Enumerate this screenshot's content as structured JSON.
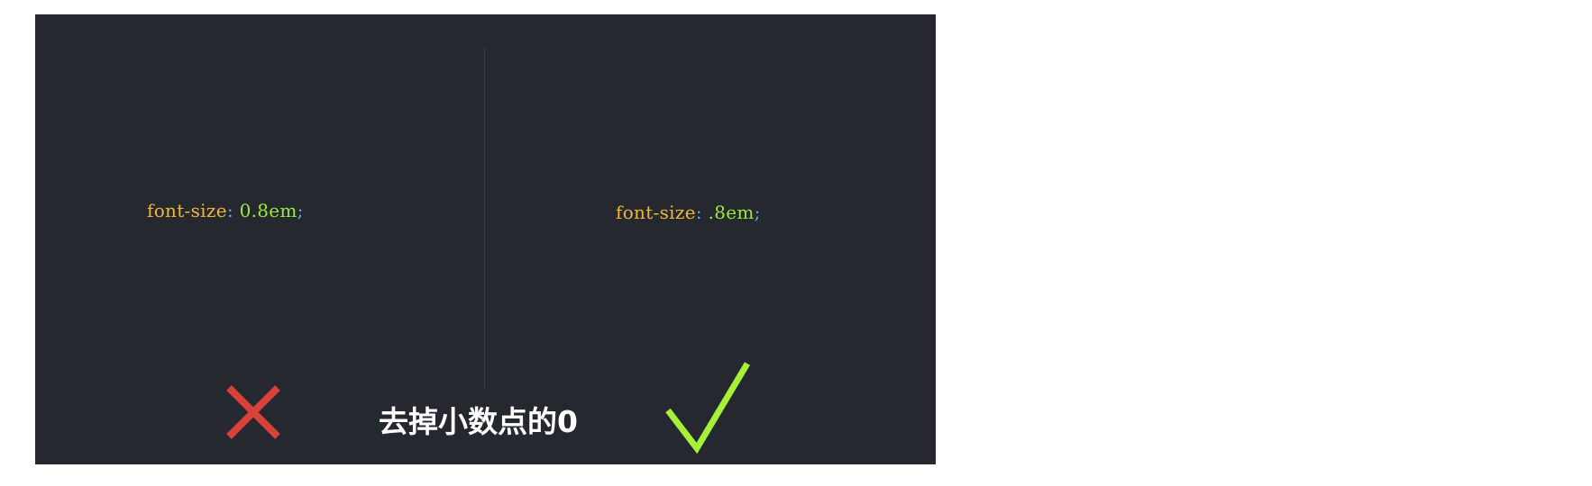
{
  "left_example": {
    "property": "font-size",
    "colon": ":",
    "value": " 0.8em",
    "semicolon": ";"
  },
  "right_example": {
    "property": "font-size",
    "colon": ":",
    "value": " .8em",
    "semicolon": ";"
  },
  "caption": "去掉小数点的0",
  "icons": {
    "wrong": "cross-icon",
    "right": "check-icon"
  },
  "colors": {
    "background": "#262830",
    "property": "#f0b932",
    "punctuation": "#6ea9d9",
    "value": "#9be83a",
    "cross": "#d9413b",
    "check": "#a6f03a"
  }
}
